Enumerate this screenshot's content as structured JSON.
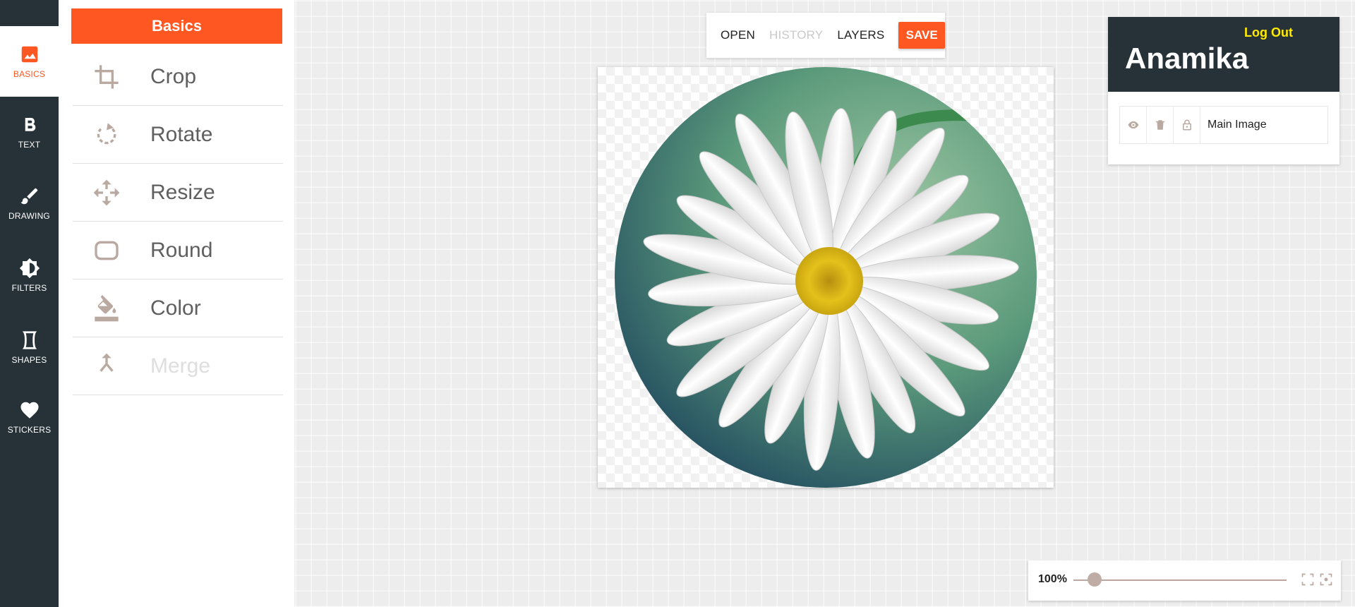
{
  "sidebar": {
    "items": [
      {
        "label": "BASICS",
        "icon": "image-icon",
        "active": true
      },
      {
        "label": "TEXT",
        "icon": "bold-text-icon"
      },
      {
        "label": "DRAWING",
        "icon": "brush-icon"
      },
      {
        "label": "FILTERS",
        "icon": "brightness-icon"
      },
      {
        "label": "SHAPES",
        "icon": "shape-icon"
      },
      {
        "label": "STICKERS",
        "icon": "heart-icon"
      }
    ]
  },
  "panel": {
    "title": "Basics",
    "tools": [
      {
        "label": "Crop",
        "icon": "crop-icon",
        "disabled": false
      },
      {
        "label": "Rotate",
        "icon": "rotate-icon",
        "disabled": false
      },
      {
        "label": "Resize",
        "icon": "resize-icon",
        "disabled": false
      },
      {
        "label": "Round",
        "icon": "round-corners-icon",
        "disabled": false
      },
      {
        "label": "Color",
        "icon": "paint-bucket-icon",
        "disabled": false
      },
      {
        "label": "Merge",
        "icon": "merge-icon",
        "disabled": true
      }
    ]
  },
  "toolbar": {
    "open": "OPEN",
    "history": "HISTORY",
    "layers": "LAYERS",
    "save": "SAVE"
  },
  "user": {
    "name": "Anamika",
    "logout": "Log Out"
  },
  "layers": [
    {
      "name": "Main Image"
    }
  ],
  "zoom": {
    "value": "100%",
    "slider_fraction": 0.1
  },
  "colors": {
    "accent": "#ff5722",
    "rail": "#263238",
    "logout": "#ffea00"
  }
}
